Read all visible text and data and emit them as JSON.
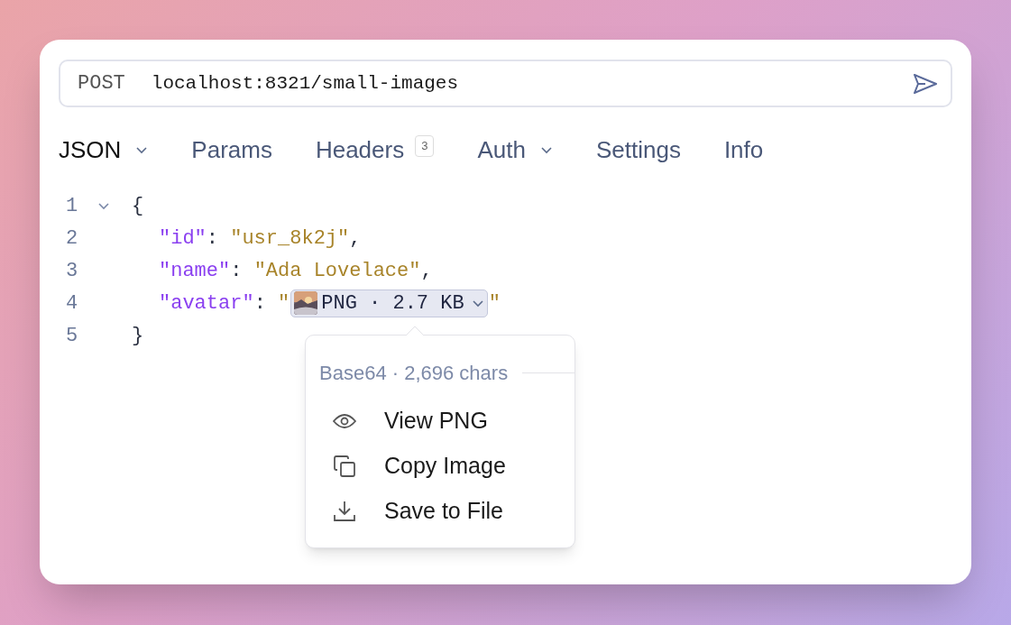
{
  "request": {
    "method": "POST",
    "url": "localhost:8321/small-images"
  },
  "tabs": [
    {
      "label": "JSON",
      "selected": true,
      "dropdown": true
    },
    {
      "label": "Params",
      "selected": false
    },
    {
      "label": "Headers",
      "selected": false,
      "badge": "3"
    },
    {
      "label": "Auth",
      "selected": false,
      "dropdown": true
    },
    {
      "label": "Settings",
      "selected": false
    },
    {
      "label": "Info",
      "selected": false
    }
  ],
  "code": [
    {
      "number": "1",
      "expanded": true,
      "tokens": [
        {
          "kind": "punct",
          "text": "{"
        }
      ],
      "children": [
        {
          "number": "2",
          "tokens": [
            {
              "kind": "key",
              "text": "\"id\""
            },
            {
              "kind": "punct",
              "text": ": "
            },
            {
              "kind": "string",
              "text": "\"usr_8k2j\""
            },
            {
              "kind": "punct",
              "text": ","
            }
          ]
        },
        {
          "number": "3",
          "tokens": [
            {
              "kind": "key",
              "text": "\"name\""
            },
            {
              "kind": "punct",
              "text": ": "
            },
            {
              "kind": "string",
              "text": "\"Ada Lovelace\""
            },
            {
              "kind": "punct",
              "text": ","
            }
          ]
        },
        {
          "number": "4",
          "tokens": [
            {
              "kind": "key",
              "text": "\"avatar\""
            },
            {
              "kind": "punct",
              "text": ": "
            },
            {
              "kind": "string",
              "text": "\""
            },
            {
              "kind": "chip",
              "text": "PNG · 2.7 KB"
            },
            {
              "kind": "string",
              "text": "\""
            }
          ]
        }
      ]
    },
    {
      "number": "5",
      "tokens": [
        {
          "kind": "punct",
          "text": "}"
        }
      ]
    }
  ],
  "popup": {
    "header": "Base64 · 2,696 chars",
    "items": [
      {
        "kind": "view",
        "label": "View PNG"
      },
      {
        "kind": "copy",
        "label": "Copy Image"
      },
      {
        "kind": "save",
        "label": "Save to File"
      }
    ]
  }
}
